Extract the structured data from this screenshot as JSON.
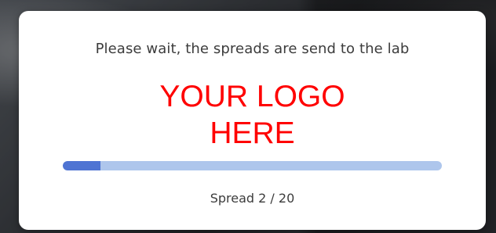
{
  "dialog": {
    "message": "Please wait, the spreads are send to the lab",
    "logo": {
      "line1": "YOUR LOGO",
      "line2": "HERE",
      "color": "#ff0000"
    },
    "progress": {
      "fraction": 0.1,
      "track_color": "#aec6ec",
      "fill_color": "#4f74d3"
    },
    "counter": "Spread 2 / 20"
  }
}
